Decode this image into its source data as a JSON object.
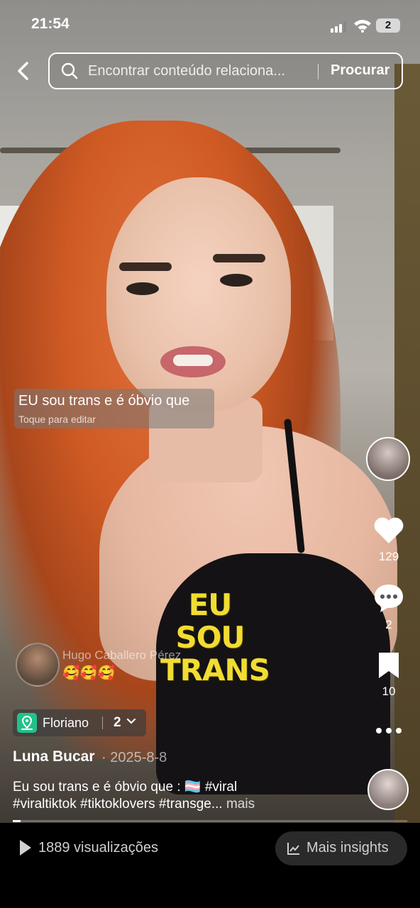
{
  "status_bar": {
    "time": "21:54",
    "battery": "2"
  },
  "search": {
    "placeholder": "Encontrar conteúdo relaciona...",
    "button": "Procurar"
  },
  "caption": {
    "text": "EU sou trans e é óbvio que",
    "hint": "Toque para editar"
  },
  "sticker": {
    "line1": "EU SOU",
    "line2": "TRANS"
  },
  "comment": {
    "author": "Hugo Caballero Pérez",
    "text": "🥰🥰🥰"
  },
  "actions": {
    "likes": "129",
    "comments": "2",
    "saves": "10"
  },
  "location": {
    "name": "Floriano",
    "count": "2"
  },
  "post": {
    "author": "Luna Bucar",
    "date": "· 2025-8-8",
    "description_line1": "Eu sou trans e é óbvio que :  🏳️‍⚧️  #viral",
    "description_line2": "#viraltiktok #tiktoklovers #transge...",
    "more": " mais",
    "progress": 0.02
  },
  "bottom": {
    "views": "1889 visualizações",
    "insights": "Mais insights"
  }
}
